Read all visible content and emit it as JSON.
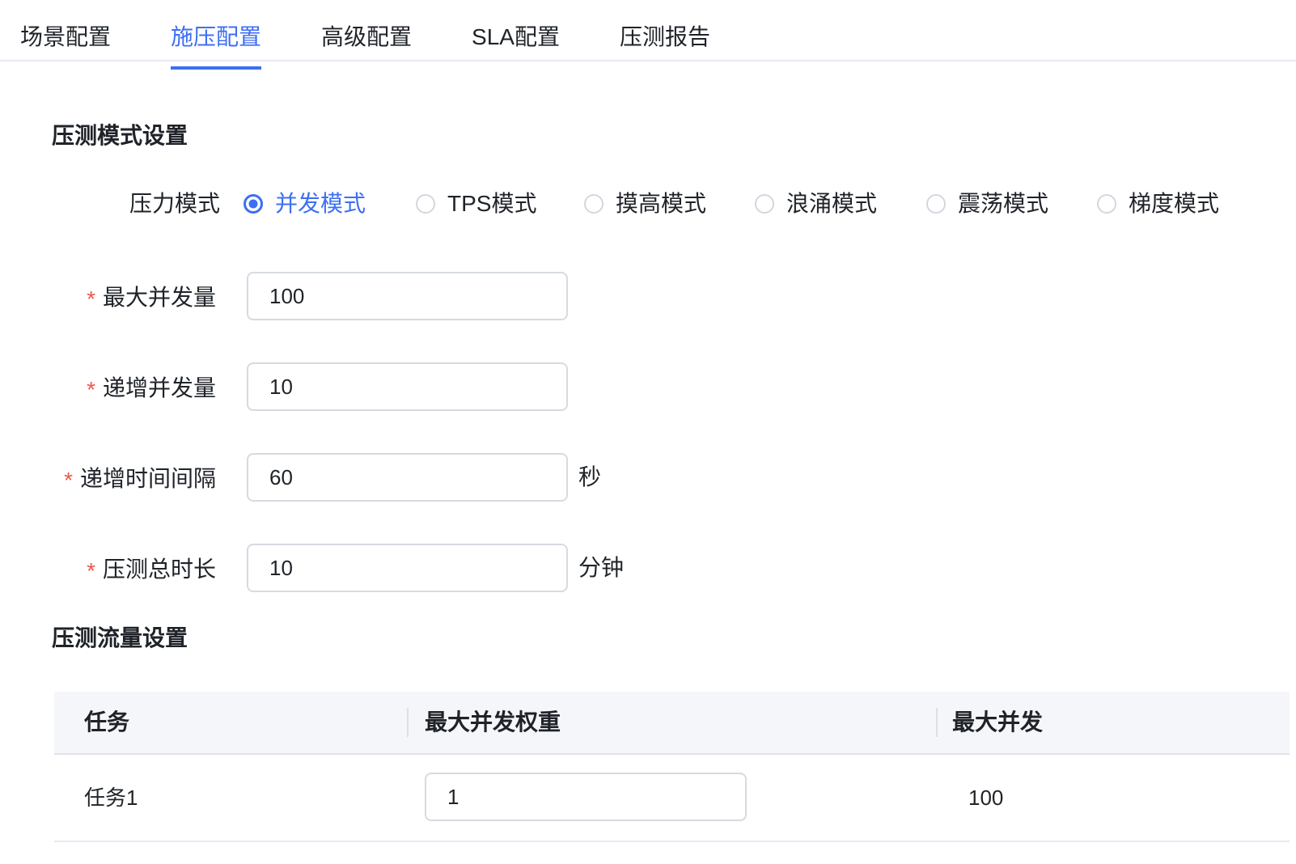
{
  "tabs": [
    {
      "label": "场景配置",
      "active": false
    },
    {
      "label": "施压配置",
      "active": true
    },
    {
      "label": "高级配置",
      "active": false
    },
    {
      "label": "SLA配置",
      "active": false
    },
    {
      "label": "压测报告",
      "active": false
    }
  ],
  "mode_section": {
    "title": "压测模式设置",
    "required_marker": "*",
    "pressure_mode": {
      "label": "压力模式",
      "options": [
        {
          "label": "并发模式",
          "selected": true
        },
        {
          "label": "TPS模式",
          "selected": false
        },
        {
          "label": "摸高模式",
          "selected": false
        },
        {
          "label": "浪涌模式",
          "selected": false
        },
        {
          "label": "震荡模式",
          "selected": false
        },
        {
          "label": "梯度模式",
          "selected": false
        }
      ]
    },
    "fields": [
      {
        "label": "最大并发量",
        "required": true,
        "value": "100",
        "unit": ""
      },
      {
        "label": "递增并发量",
        "required": true,
        "value": "10",
        "unit": ""
      },
      {
        "label": "递增时间间隔",
        "required": true,
        "value": "60",
        "unit": "秒"
      },
      {
        "label": "压测总时长",
        "required": true,
        "value": "10",
        "unit": "分钟"
      }
    ]
  },
  "traffic_section": {
    "title": "压测流量设置",
    "table": {
      "headers": [
        "任务",
        "最大并发权重",
        "最大并发"
      ],
      "rows": [
        {
          "task": "任务1",
          "weight_value": "1",
          "max_concurrency": "100"
        }
      ]
    }
  },
  "icons": {
    "radio_selected": "filled-ring-dot",
    "radio_unselected": "empty-circle"
  },
  "colors": {
    "accent_blue": "#3d6ff2",
    "required_red": "#f2564a",
    "text_primary": "#1f2329",
    "input_border": "#d7dae1",
    "table_header_bg": "#f5f6f9",
    "divider_gray": "#e8eaf1"
  }
}
